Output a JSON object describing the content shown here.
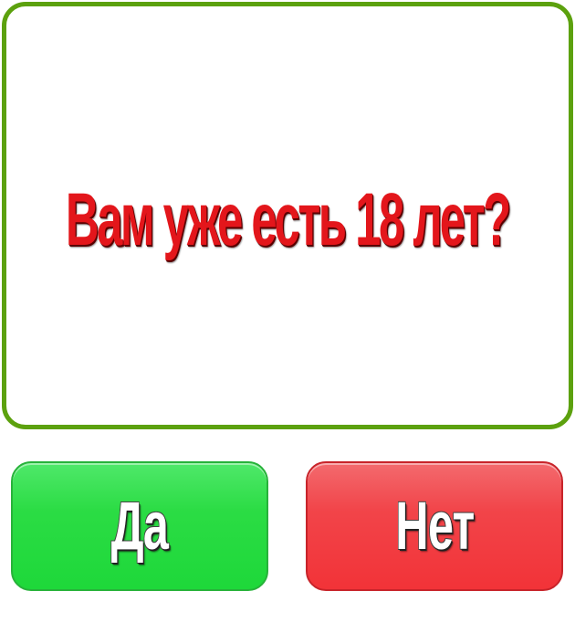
{
  "question": {
    "text": "Вам уже есть 18 лет?"
  },
  "buttons": {
    "yes_label": "Да",
    "no_label": "Нет"
  },
  "colors": {
    "panel_border": "#5ca10e",
    "question_text": "#e3161b",
    "yes_button": "#1ed83a",
    "no_button": "#f23338"
  }
}
